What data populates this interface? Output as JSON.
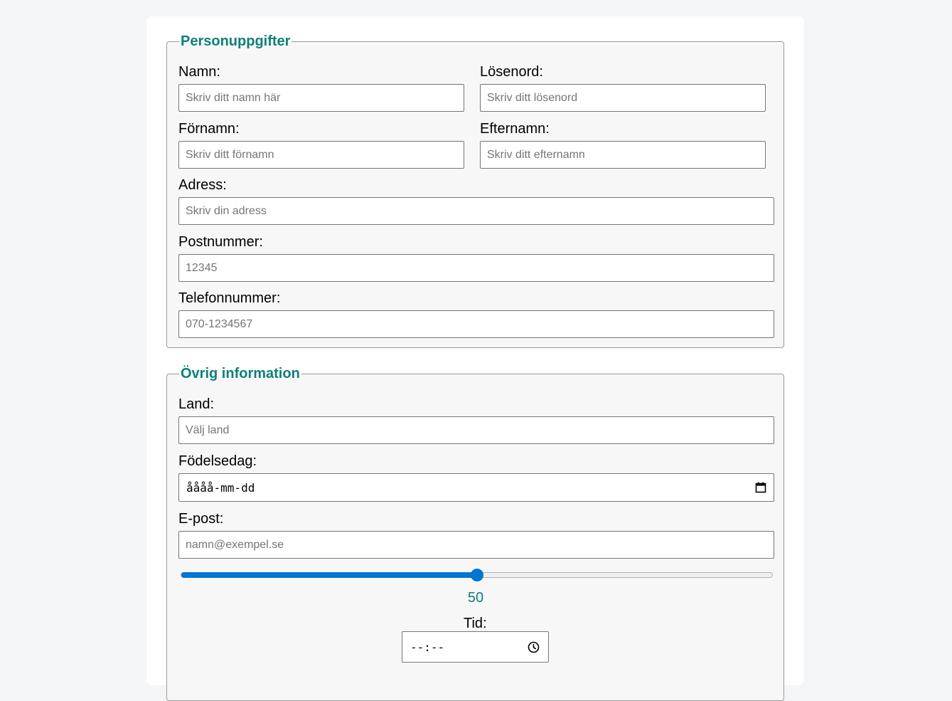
{
  "section_personal": {
    "legend": "Personuppgifter",
    "fields": {
      "namn": {
        "label": "Namn:",
        "placeholder": "Skriv ditt namn här",
        "value": ""
      },
      "losenord": {
        "label": "Lösenord:",
        "placeholder": "Skriv ditt lösenord",
        "value": ""
      },
      "fornamn": {
        "label": "Förnamn:",
        "placeholder": "Skriv ditt förnamn",
        "value": ""
      },
      "efternamn": {
        "label": "Efternamn:",
        "placeholder": "Skriv ditt efternamn",
        "value": ""
      },
      "adress": {
        "label": "Adress:",
        "placeholder": "Skriv din adress",
        "value": ""
      },
      "postnummer": {
        "label": "Postnummer:",
        "placeholder": "12345",
        "value": ""
      },
      "telefon": {
        "label": "Telefonnummer:",
        "placeholder": "070-1234567",
        "value": ""
      }
    }
  },
  "section_other": {
    "legend": "Övrig information",
    "fields": {
      "land": {
        "label": "Land:",
        "placeholder": "Välj land",
        "value": ""
      },
      "fodelsedag": {
        "label": "Födelsedag:",
        "display": "åååå-mm-dd",
        "icon": "calendar-icon"
      },
      "epost": {
        "label": "E-post:",
        "placeholder": "namn@exempel.se",
        "value": ""
      },
      "range": {
        "value": "50",
        "min": 0,
        "max": 100
      },
      "tid": {
        "label": "Tid:",
        "display": "--:--",
        "icon": "clock-icon"
      }
    }
  },
  "colors": {
    "accent": "#0d7f7b",
    "slider": "#0075d1",
    "background": "#f4f5f6",
    "fieldset_bg": "#f7f7f7"
  }
}
